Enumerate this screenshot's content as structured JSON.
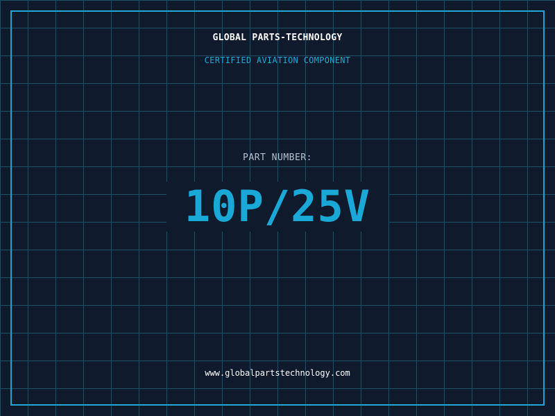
{
  "header": {
    "company_name": "GLOBAL PARTS-TECHNOLOGY",
    "subtitle": "CERTIFIED AVIATION COMPONENT"
  },
  "part": {
    "label": "PART NUMBER:",
    "number": "10P/25V"
  },
  "footer": {
    "website": "www.globalpartstechnology.com"
  },
  "colors": {
    "background": "#101a2d",
    "grid": "#1f4f66",
    "accent": "#1aa7d1",
    "text_primary": "#ffffff",
    "text_muted": "#b6c2cf"
  }
}
